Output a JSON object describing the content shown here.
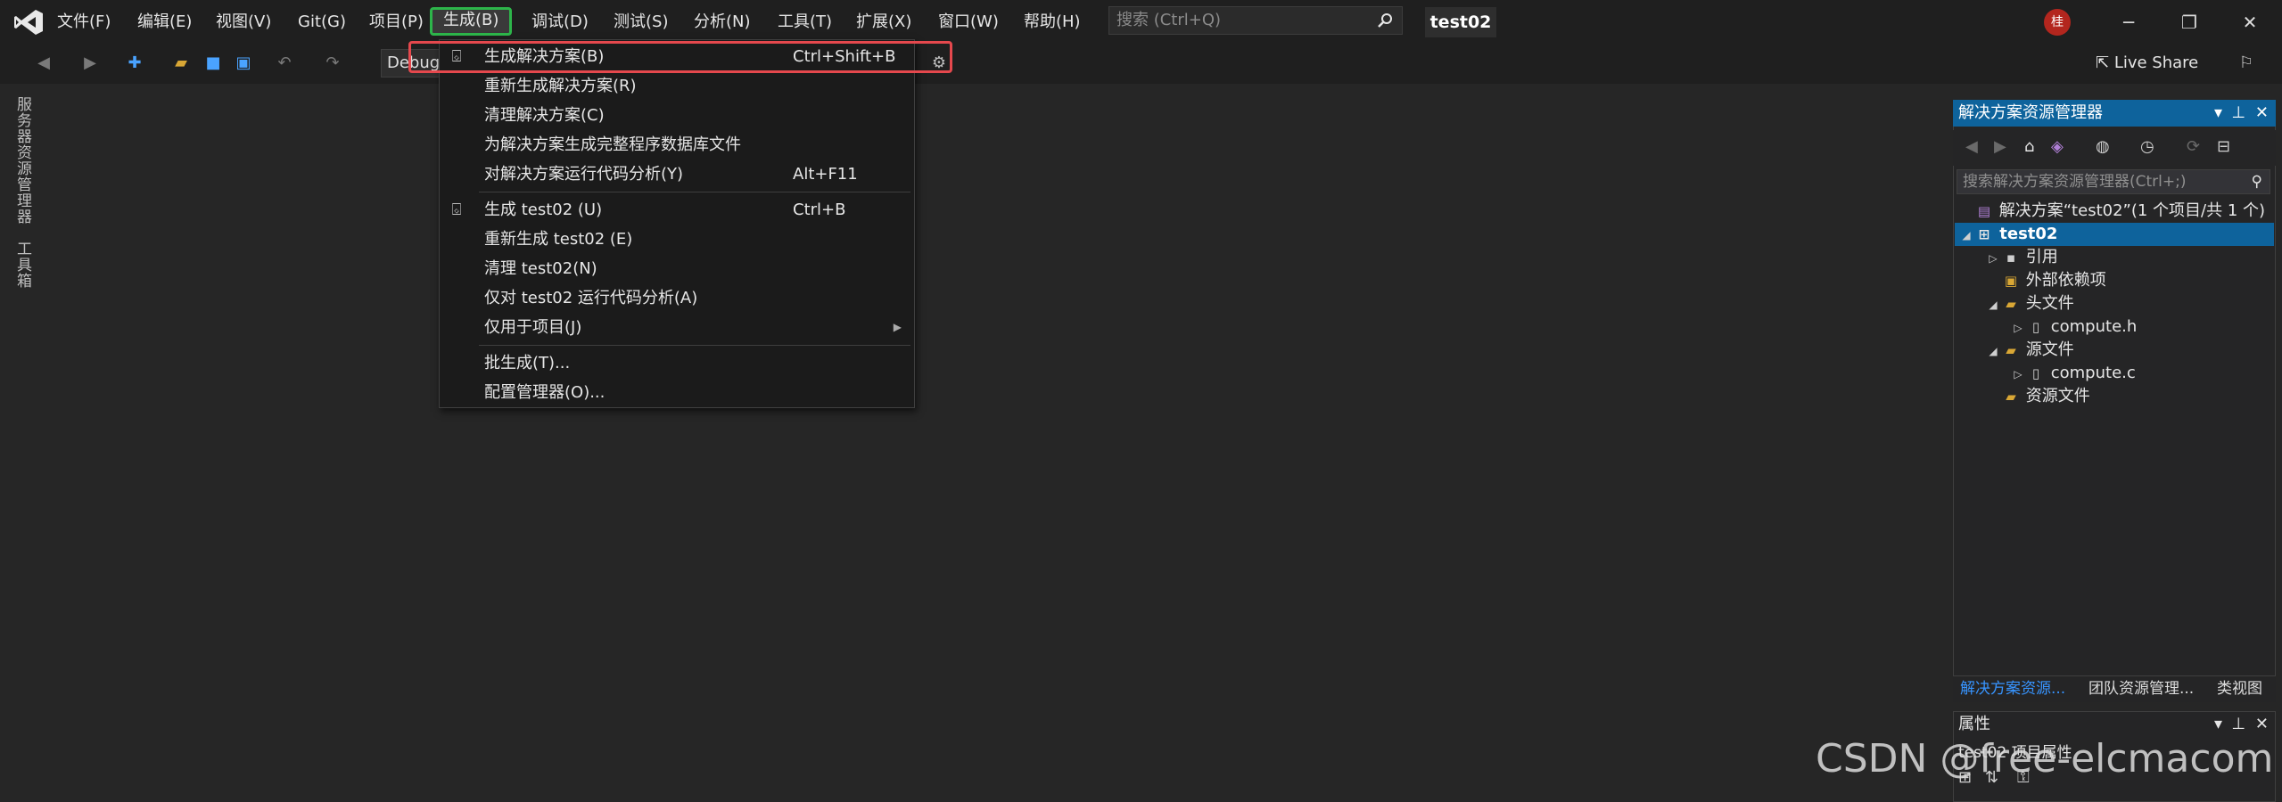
{
  "menubar": {
    "items": [
      "文件(F)",
      "编辑(E)",
      "视图(V)",
      "Git(G)",
      "项目(P)",
      "生成(B)",
      "调试(D)",
      "测试(S)",
      "分析(N)",
      "工具(T)",
      "扩展(X)",
      "窗口(W)",
      "帮助(H)"
    ],
    "active": "生成(B)"
  },
  "search": {
    "placeholder": "搜索 (Ctrl+Q)"
  },
  "project_title": "test02",
  "avatar_initial": "桂",
  "toolbar": {
    "config": "Debug",
    "live_share": "Live Share"
  },
  "left_tabs": [
    "服务器资源管理器",
    "工具箱"
  ],
  "build_menu": {
    "items": [
      {
        "label": "生成解决方案(B)",
        "shortcut": "Ctrl+Shift+B",
        "icon": "build-icon",
        "highlighted": true
      },
      {
        "label": "重新生成解决方案(R)",
        "shortcut": ""
      },
      {
        "label": "清理解决方案(C)",
        "shortcut": ""
      },
      {
        "label": "为解决方案生成完整程序数据库文件",
        "shortcut": ""
      },
      {
        "label": "对解决方案运行代码分析(Y)",
        "shortcut": "Alt+F11"
      },
      {
        "label": "生成 test02 (U)",
        "shortcut": "Ctrl+B",
        "icon": "build-icon"
      },
      {
        "label": "重新生成 test02 (E)",
        "shortcut": ""
      },
      {
        "label": "清理 test02(N)",
        "shortcut": ""
      },
      {
        "label": "仅对 test02 运行代码分析(A)",
        "shortcut": ""
      },
      {
        "label": "仅用于项目(J)",
        "shortcut": "",
        "submenu": true
      },
      {
        "label": "批生成(T)...",
        "shortcut": ""
      },
      {
        "label": "配置管理器(O)...",
        "shortcut": ""
      }
    ]
  },
  "solution_explorer": {
    "title": "解决方案资源管理器",
    "search_placeholder": "搜索解决方案资源管理器(Ctrl+;)",
    "tree": [
      {
        "label": "解决方案“test02”(1 个项目/共 1 个)"
      },
      {
        "label": "test02",
        "selected": true
      },
      {
        "label": "引用"
      },
      {
        "label": "外部依赖项"
      },
      {
        "label": "头文件"
      },
      {
        "label": "compute.h"
      },
      {
        "label": "源文件"
      },
      {
        "label": "compute.c"
      },
      {
        "label": "资源文件"
      }
    ],
    "tabs": [
      "解决方案资源...",
      "团队资源管理...",
      "类视图"
    ]
  },
  "properties": {
    "title": "属性",
    "subtitle": "test02  项目属性"
  },
  "watermark": "CSDN @free-elcmacom",
  "colors": {
    "accent": "#0e639c",
    "green_box": "#2db54a",
    "red_box": "#e5484d"
  }
}
